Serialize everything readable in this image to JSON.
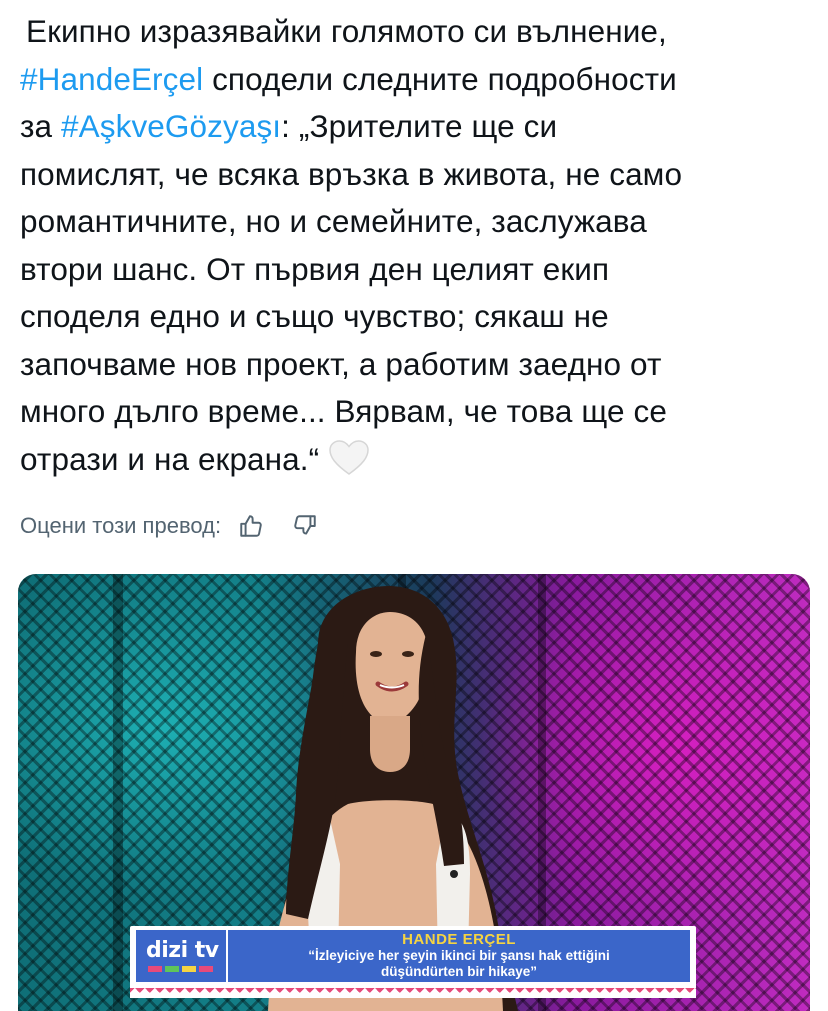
{
  "tweet": {
    "line1": "Екипно изразявайки голямото си вълнение,",
    "hashtag1": "#HandeErçel",
    "line2_rest": " сподели следните подробности",
    "line3_pre": "за ",
    "hashtag2": "#AşkveGözyaşı",
    "line3_rest": ": „Зрителите ще си",
    "line4": "помислят, че всяка връзка в живота, не само",
    "line5": "романтичните, но и семейните, заслужава",
    "line6": "втори шанс. От първия ден целият екип",
    "line7": "споделя едно и също чувство; сякаш не",
    "line8": "започваме нов проект, а работим заедно от",
    "line9": "много дълго време... Вярвам, че това ще се",
    "line10": "отрази и на екрана.“",
    "emoji": "white-heart-emoji"
  },
  "translation_rating": {
    "label": "Оцени този превод:",
    "like_icon": "thumbs-up-icon",
    "dislike_icon": "thumbs-down-icon"
  },
  "media": {
    "lower_third": {
      "logo": "dizi tv",
      "name": "HANDE ERÇEL",
      "quote_line1": "“İzleyiciye her şeyin ikinci bir şansı hak ettiğini",
      "quote_line2": "düşündürten bir hikaye”"
    },
    "colors": {
      "hashtag": "#1d9bf0",
      "lower_third_blue": "#3b66c9",
      "name_yellow": "#f5d442"
    }
  }
}
